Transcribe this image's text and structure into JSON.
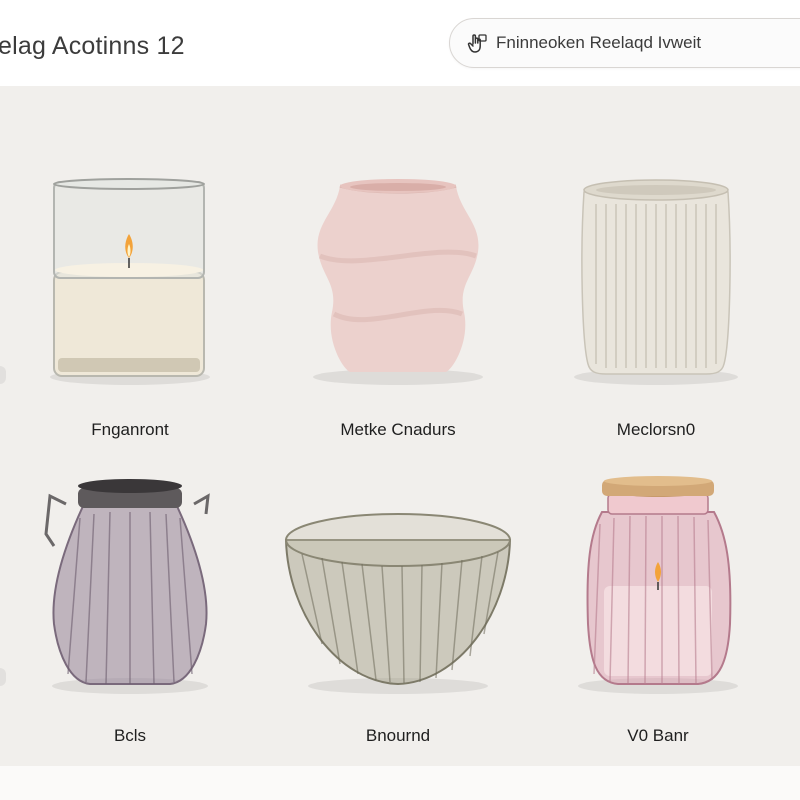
{
  "header": {
    "title": "elag Acotinns 12",
    "search": {
      "value": "Fninneoken Reelaqd Ivweit",
      "icon": "filter-hand-icon"
    }
  },
  "products": [
    {
      "label": "Fnganront",
      "item": "glass-candle-jar"
    },
    {
      "label": "Metke Cnadurs",
      "item": "wavy-ceramic-vase"
    },
    {
      "label": "Meclorsn0",
      "item": "ribbed-ceramic-pot"
    },
    {
      "label": "Bcls",
      "item": "clip-top-glass-jar"
    },
    {
      "label": "Bnournd",
      "item": "ribbed-glass-bowl"
    },
    {
      "label": "V0 Banr",
      "item": "pink-ribbed-candle-jar"
    }
  ],
  "colors": {
    "background": "#f1efec",
    "topbar": "#ffffff",
    "text": "#1f1f1f"
  }
}
